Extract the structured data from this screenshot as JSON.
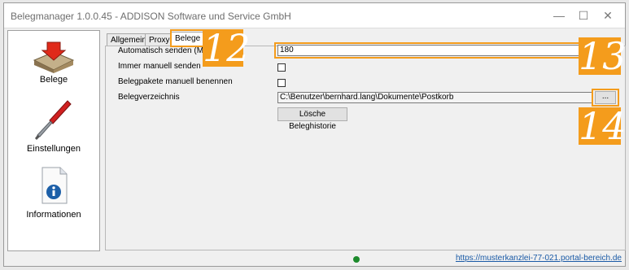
{
  "window": {
    "title": "Belegmanager 1.0.0.45 - ADDISON Software und Service GmbH",
    "minimize_glyph": "—",
    "maximize_glyph": "☐",
    "close_glyph": "✕"
  },
  "sidebar": {
    "items": [
      {
        "label": "Belege",
        "icon": "inbox-tray-icon"
      },
      {
        "label": "Einstellungen",
        "icon": "screwdriver-icon"
      },
      {
        "label": "Informationen",
        "icon": "info-document-icon"
      }
    ]
  },
  "tabs": [
    {
      "label": "Allgemein"
    },
    {
      "label": "Proxy"
    },
    {
      "label": "Belege",
      "active": true
    }
  ],
  "form": {
    "auto_send_label": "Automatisch senden (Minute",
    "auto_send_value": "180",
    "manual_send_label": "Immer manuell senden",
    "manual_send_checked": false,
    "rename_label": "Belegpakete manuell benennen",
    "rename_checked": false,
    "dir_label": "Belegverzeichnis",
    "dir_value": "C:\\Benutzer\\bernhard.lang\\Dokumente\\Postkorb",
    "browse_label": "...",
    "clear_history_label": "Lösche Beleghistorie"
  },
  "callouts": {
    "n12": "12",
    "n13": "13",
    "n14": "14"
  },
  "status": {
    "url": "https://musterkanzlei-77-021.portal-bereich.de"
  },
  "colors": {
    "callout": "#f49c1c",
    "online": "#1d8a2c"
  }
}
